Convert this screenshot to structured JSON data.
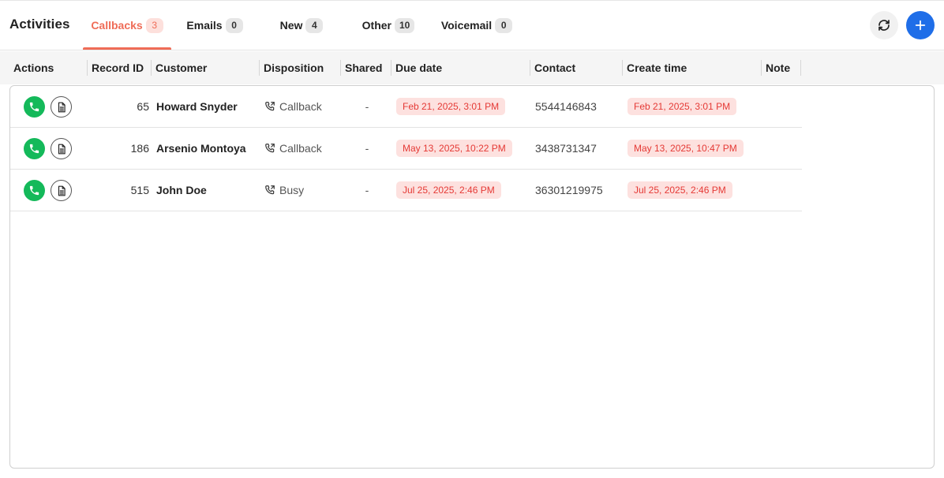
{
  "header": {
    "title": "Activities",
    "tabs": [
      {
        "label": "Callbacks",
        "count": "3",
        "active": true
      },
      {
        "label": "Emails",
        "count": "0",
        "active": false
      },
      {
        "label": "New",
        "count": "4",
        "active": false
      },
      {
        "label": "Other",
        "count": "10",
        "active": false
      },
      {
        "label": "Voicemail",
        "count": "0",
        "active": false
      }
    ],
    "refresh_icon": "refresh-icon",
    "add_icon": "plus-icon"
  },
  "table": {
    "columns": [
      "Actions",
      "Record ID",
      "Customer",
      "Disposition",
      "Shared",
      "Due date",
      "Contact",
      "Create time",
      "Note"
    ],
    "rows": [
      {
        "record_id": "65",
        "customer": "Howard Snyder",
        "disposition": "Callback",
        "shared": "-",
        "due_date": "Feb 21, 2025, 3:01 PM",
        "contact": "5544146843",
        "create_time": "Feb 21, 2025, 3:01 PM",
        "note": ""
      },
      {
        "record_id": "186",
        "customer": "Arsenio Montoya",
        "disposition": "Callback",
        "shared": "-",
        "due_date": "May 13, 2025, 10:22 PM",
        "contact": "3438731347",
        "create_time": "May 13, 2025, 10:47 PM",
        "note": ""
      },
      {
        "record_id": "515",
        "customer": "John Doe",
        "disposition": "Busy",
        "shared": "-",
        "due_date": "Jul 25, 2025, 2:46 PM",
        "contact": "36301219975",
        "create_time": "Jul 25, 2025, 2:46 PM",
        "note": ""
      }
    ]
  },
  "colors": {
    "accent": "#ef6c57",
    "call_green": "#14b95a",
    "add_blue": "#1f6ee8",
    "date_pill_bg": "#fde1df",
    "date_pill_text": "#e53935"
  }
}
